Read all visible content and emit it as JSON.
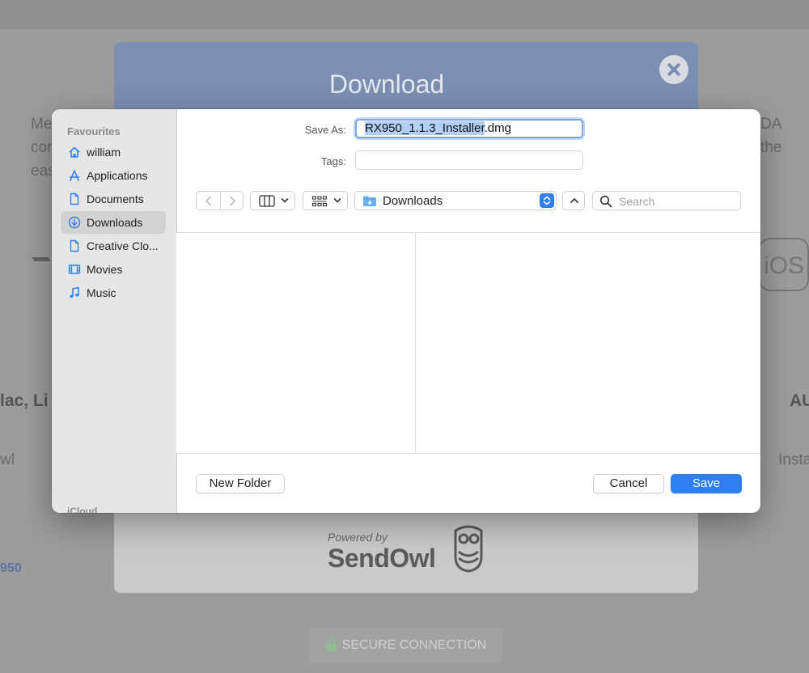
{
  "background": {
    "left_fragments": [
      "Me",
      "con",
      "eas"
    ],
    "right_fragments": [
      "DA",
      "the"
    ],
    "heading_left": "lac, Li",
    "heading_right": "AU",
    "text_left": "wl",
    "text_right": "Insta",
    "bottom_left": "950",
    "ios_badge": "iOS"
  },
  "sendowl_modal": {
    "title": "Download",
    "powered_by": "Powered by",
    "brand": "SendOwl",
    "secure_connection": "SECURE CONNECTION"
  },
  "save_dialog": {
    "sidebar": {
      "heading": "Favourites",
      "items": [
        {
          "label": "william",
          "icon": "home-icon",
          "selected": false
        },
        {
          "label": "Applications",
          "icon": "applications-icon",
          "selected": false
        },
        {
          "label": "Documents",
          "icon": "document-icon",
          "selected": false
        },
        {
          "label": "Downloads",
          "icon": "download-icon",
          "selected": true
        },
        {
          "label": "Creative Clo...",
          "icon": "document-icon",
          "selected": false
        },
        {
          "label": "Movies",
          "icon": "film-icon",
          "selected": false
        },
        {
          "label": "Music",
          "icon": "music-note-icon",
          "selected": false
        }
      ],
      "icloud_heading": "iCloud"
    },
    "save_as_label": "Save As:",
    "filename_selected": "RX950_1.1.3_Installer",
    "filename_ext": ".dmg",
    "tags_label": "Tags:",
    "location": "Downloads",
    "search_placeholder": "Search",
    "new_folder_label": "New Folder",
    "cancel_label": "Cancel",
    "save_label": "Save",
    "accent_color": "#2f7ff0"
  }
}
